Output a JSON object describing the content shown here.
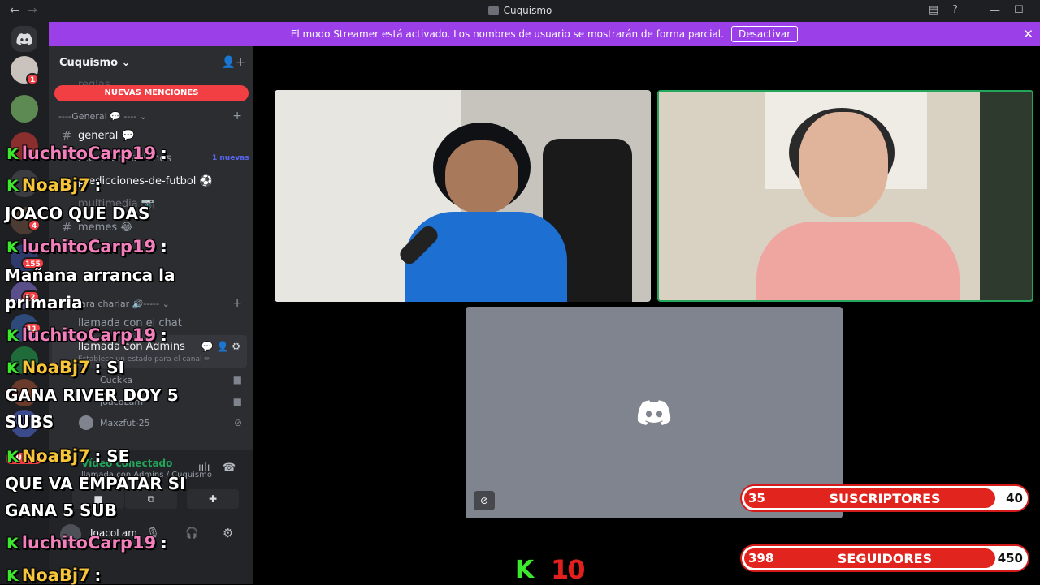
{
  "titlebar": {
    "title": "Cuquismo",
    "back": "←",
    "forward": "→"
  },
  "banner": {
    "text": "El modo Streamer está activado. Los nombres de usuario se mostrarán de forma parcial.",
    "button": "Desactivar",
    "close": "✕",
    "color": "#9b3fe8"
  },
  "rail": {
    "badges": [
      "1",
      "4",
      "155",
      "22",
      "11"
    ],
    "new_pill": "NUEVO"
  },
  "sidebar": {
    "server_name": "Cuquismo",
    "mentions_label": "NUEVAS MENCIONES",
    "cat_general": "----General 💬 ----",
    "cat_voice": "para charlar 🔊-----",
    "channels": {
      "reglas": "reglas",
      "general": "general 💬",
      "recomendaciones": "recomendaciones",
      "predicciones": "predicciones-de-futbol ⚽",
      "multimedia": "multimedia 📷",
      "memes": "memes 😂"
    },
    "new_count": "1 nuevas",
    "voice": {
      "chat": "llamada con el chat",
      "admins": "llamada con Admins",
      "admins_status": "Establece un estado para el canal ✏",
      "users": [
        "Cuckka",
        "JoacoLam",
        "Maxzfut-25"
      ]
    },
    "rtc": {
      "status": "Vídeo conectado",
      "channel": "llamada con Admins / Cuquismo"
    },
    "user": {
      "name": "JoacoLam"
    }
  },
  "counters": [
    {
      "left": "35",
      "label": "SUSCRIPTORES",
      "right": "40"
    },
    {
      "left": "398",
      "label": "SEGUIDORES",
      "right": "450"
    }
  ],
  "kick_goal": {
    "logo": "K",
    "count": "10"
  },
  "overlay_chat": [
    {
      "user": "luchitoCarp19",
      "msg": ":"
    },
    {
      "user": "NoaBj7",
      "msg": ":"
    },
    {
      "user": "",
      "msg": "JOACO QUE DAS"
    },
    {
      "user": "luchitoCarp19",
      "msg": ":"
    },
    {
      "user": "",
      "msg": "Mañana arranca la"
    },
    {
      "user": "",
      "msg": "primaria"
    },
    {
      "user": "luchitoCarp19",
      "msg": ":"
    },
    {
      "user": "NoaBj7",
      "msg": ": SI"
    },
    {
      "user": "",
      "msg": "GANA RIVER DOY 5"
    },
    {
      "user": "",
      "msg": "SUBS"
    },
    {
      "user": "NoaBj7",
      "msg": ": SE"
    },
    {
      "user": "",
      "msg": "QUE VA EMPATAR SI"
    },
    {
      "user": "",
      "msg": "GANA 5 SUB"
    },
    {
      "user": "luchitoCarp19",
      "msg": ":"
    },
    {
      "user": "NoaBj7",
      "msg": ":"
    }
  ]
}
